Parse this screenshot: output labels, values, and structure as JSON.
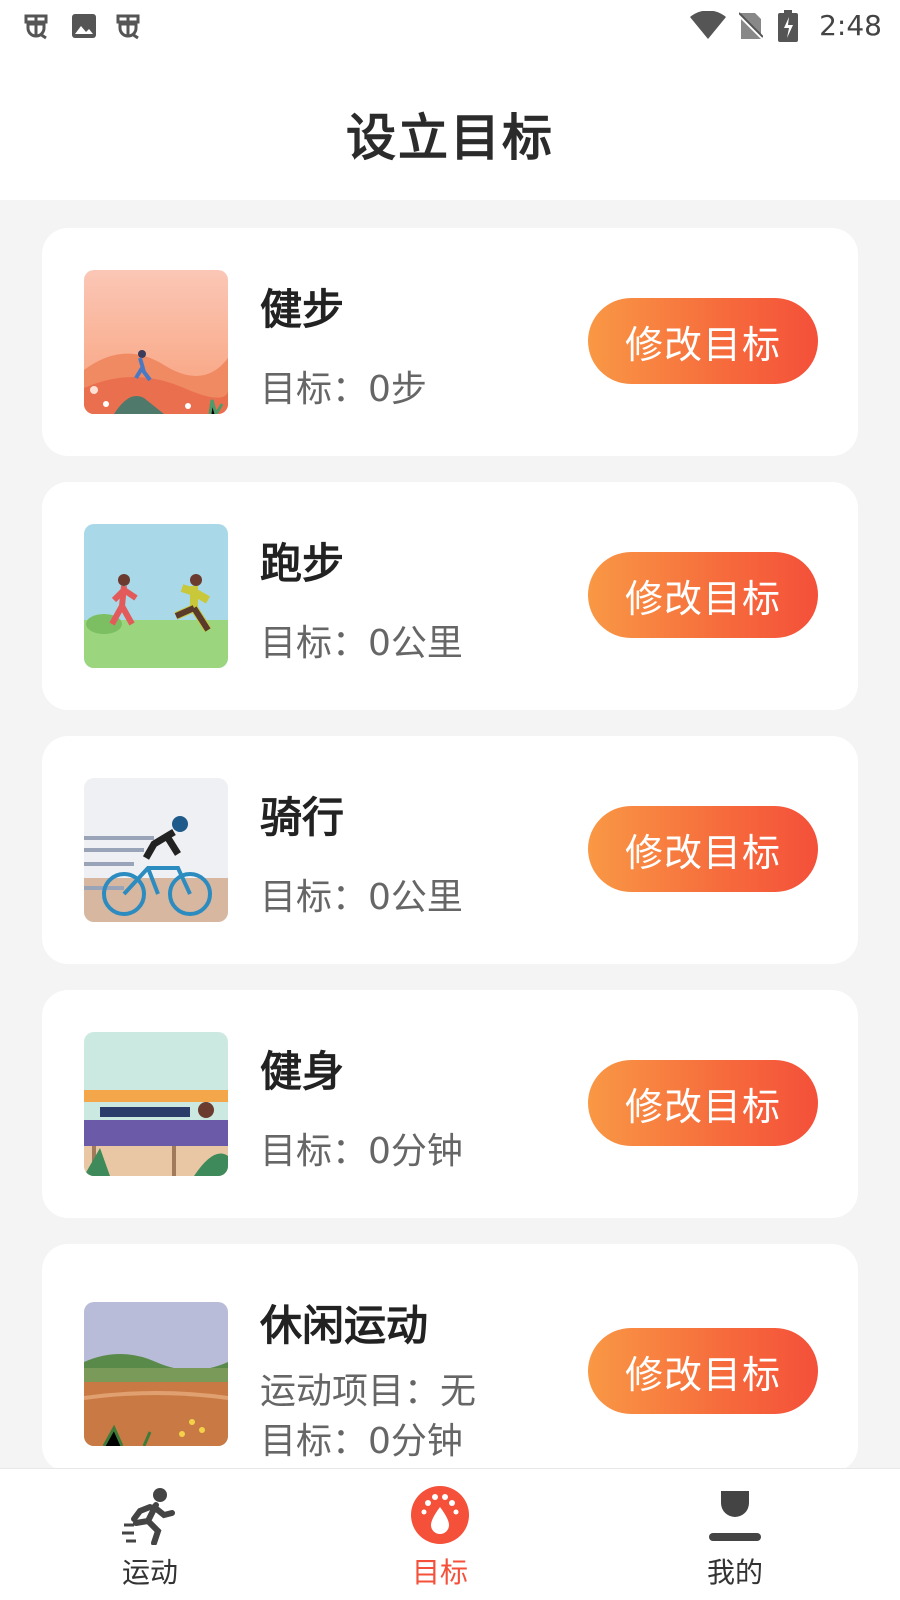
{
  "status_bar": {
    "time": "2:48",
    "left_icons": [
      "bug-icon",
      "image-icon",
      "bug-icon"
    ],
    "right_icons": [
      "wifi-icon",
      "no-sim-icon",
      "battery-charging-icon"
    ]
  },
  "header": {
    "title": "设立目标"
  },
  "goals": [
    {
      "title": "健步",
      "goal": "目标：0步",
      "button": "修改目标",
      "image": "walking-illustration"
    },
    {
      "title": "跑步",
      "goal": "目标：0公里",
      "button": "修改目标",
      "image": "running-illustration"
    },
    {
      "title": "骑行",
      "goal": "目标：0公里",
      "button": "修改目标",
      "image": "cycling-illustration"
    },
    {
      "title": "健身",
      "goal": "目标：0分钟",
      "button": "修改目标",
      "image": "fitness-illustration"
    },
    {
      "title": "休闲运动",
      "item": "运动项目：无",
      "goal": "目标：0分钟",
      "button": "修改目标",
      "image": "leisure-illustration"
    }
  ],
  "bottom_nav": {
    "items": [
      {
        "label": "运动",
        "icon": "running-person-icon",
        "active": false
      },
      {
        "label": "目标",
        "icon": "target-drop-icon",
        "active": true
      },
      {
        "label": "我的",
        "icon": "profile-icon",
        "active": false
      }
    ],
    "active_color": "#f4503a"
  },
  "colors": {
    "button_gradient_start": "#f99845",
    "button_gradient_end": "#f4503a",
    "background": "#f4f4f4"
  }
}
